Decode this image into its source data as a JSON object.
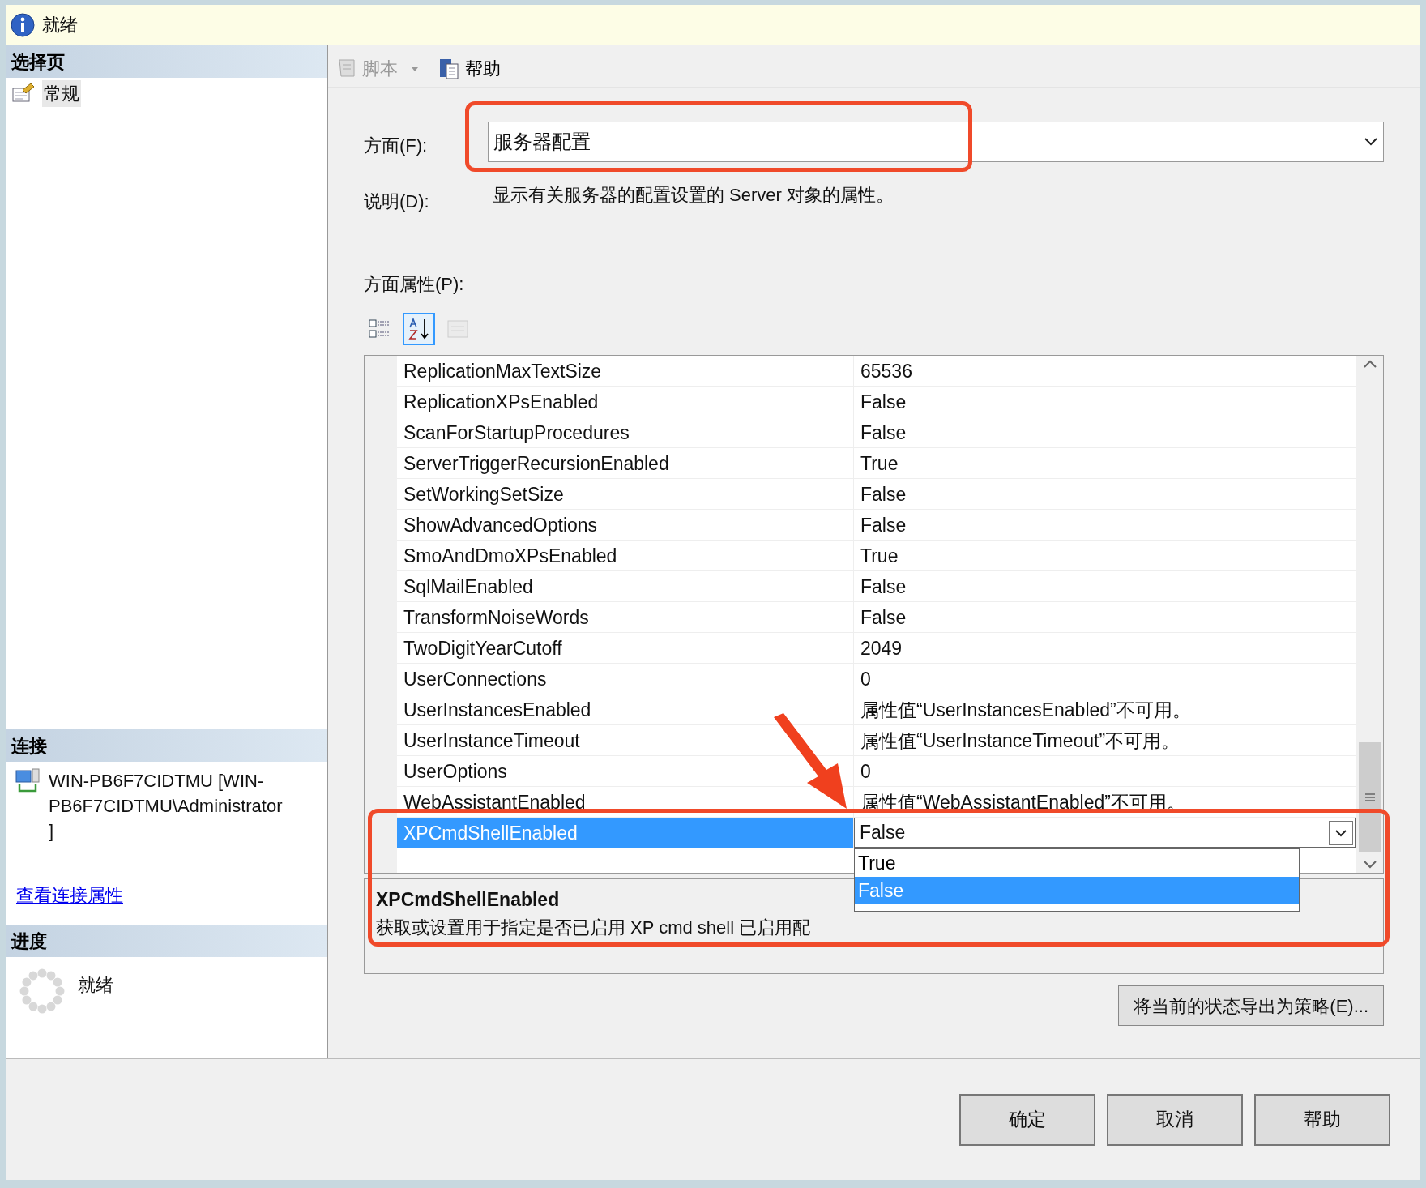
{
  "status_bar": {
    "text": "就绪"
  },
  "sidebar": {
    "pages_header": "选择页",
    "pages": [
      {
        "label": "常规",
        "selected": true
      }
    ],
    "connection_header": "连接",
    "connection": "WIN-PB6F7CIDTMU [WIN-PB6F7CIDTMU\\Administrator]",
    "connection_link": "查看连接属性",
    "progress_header": "进度",
    "progress_status": "就绪"
  },
  "toolbar": [
    {
      "label": "脚本",
      "disabled": true,
      "has_menu": true
    },
    {
      "label": "帮助",
      "disabled": false,
      "has_menu": false
    }
  ],
  "facet": {
    "label": "方面(F):",
    "value": "服务器配置"
  },
  "description": {
    "label": "说明(D):",
    "text": "显示有关服务器的配置设置的 Server 对象的属性。"
  },
  "properties_label": "方面属性(P):",
  "grid_toolbar": [
    {
      "kind": "categorized",
      "selected": false,
      "disabled": false
    },
    {
      "kind": "alphabetical",
      "selected": true,
      "disabled": false
    },
    {
      "kind": "pages",
      "selected": false,
      "disabled": true
    }
  ],
  "rows": [
    {
      "name": "ReplicationMaxTextSize",
      "value": "65536",
      "selected": false
    },
    {
      "name": "ReplicationXPsEnabled",
      "value": "False",
      "selected": false
    },
    {
      "name": "ScanForStartupProcedures",
      "value": "False",
      "selected": false
    },
    {
      "name": "ServerTriggerRecursionEnabled",
      "value": "True",
      "selected": false
    },
    {
      "name": "SetWorkingSetSize",
      "value": "False",
      "selected": false
    },
    {
      "name": "ShowAdvancedOptions",
      "value": "False",
      "selected": false
    },
    {
      "name": "SmoAndDmoXPsEnabled",
      "value": "True",
      "selected": false
    },
    {
      "name": "SqlMailEnabled",
      "value": "False",
      "selected": false
    },
    {
      "name": "TransformNoiseWords",
      "value": "False",
      "selected": false
    },
    {
      "name": "TwoDigitYearCutoff",
      "value": "2049",
      "selected": false
    },
    {
      "name": "UserConnections",
      "value": "0",
      "selected": false
    },
    {
      "name": "UserInstancesEnabled",
      "value": "属性值“UserInstancesEnabled”不可用。",
      "selected": false
    },
    {
      "name": "UserInstanceTimeout",
      "value": "属性值“UserInstanceTimeout”不可用。",
      "selected": false
    },
    {
      "name": "UserOptions",
      "value": "0",
      "selected": false
    },
    {
      "name": "WebAssistantEnabled",
      "value": "属性值“WebAssistantEnabled”不可用。",
      "selected": false
    },
    {
      "name": "XPCmdShellEnabled",
      "value": "False",
      "selected": true
    }
  ],
  "dropdown_options": [
    {
      "label": "True",
      "selected": false
    },
    {
      "label": "False",
      "selected": true
    }
  ],
  "help_panel": {
    "title": "XPCmdShellEnabled",
    "text": "获取或设置用于指定是否已启用 XP cmd shell 已启用配"
  },
  "export_button": "将当前的状态导出为策略(E)...",
  "buttons": [
    "确定",
    "取消",
    "帮助"
  ]
}
